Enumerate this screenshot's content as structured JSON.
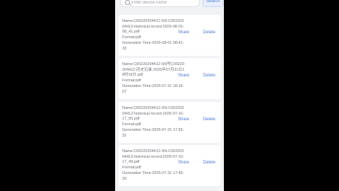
{
  "search": {
    "placeholder": "Enter device name",
    "button_label": "Search"
  },
  "records": [
    {
      "name": "Name:C00220204412-SN-C00220204412-historical record-2025-08-01-08_41.pdf",
      "format": "Format:pdf",
      "generation_time": "Generation Time:2025-08-01 08:41:33",
      "share_label": "Share",
      "delete_label": "Delete"
    },
    {
      "name": "Name:C00220204412-SN号C00220204412-历史记录-2025年07月31日18时16分.pdf",
      "format": "Format:pdf",
      "generation_time": "Generation Time:2025-07-31 18:16:07",
      "share_label": "Share",
      "delete_label": "Delete"
    },
    {
      "name": "Name:C00220204412-SN-C00220204412-historical record-2025-07-31-17_55.pdf",
      "format": "Format:pdf",
      "generation_time": "Generation Time:2025-07-31 17:55:31",
      "share_label": "Share",
      "delete_label": "Delete"
    },
    {
      "name": "Name:C00220204412-SN-C00220204412-historical record-2025-07-31-17_49.pdf",
      "format": "Format:pdf",
      "generation_time": "Generation Time:2025-07-31 17:49:33",
      "share_label": "Share",
      "delete_label": "Delete"
    }
  ]
}
